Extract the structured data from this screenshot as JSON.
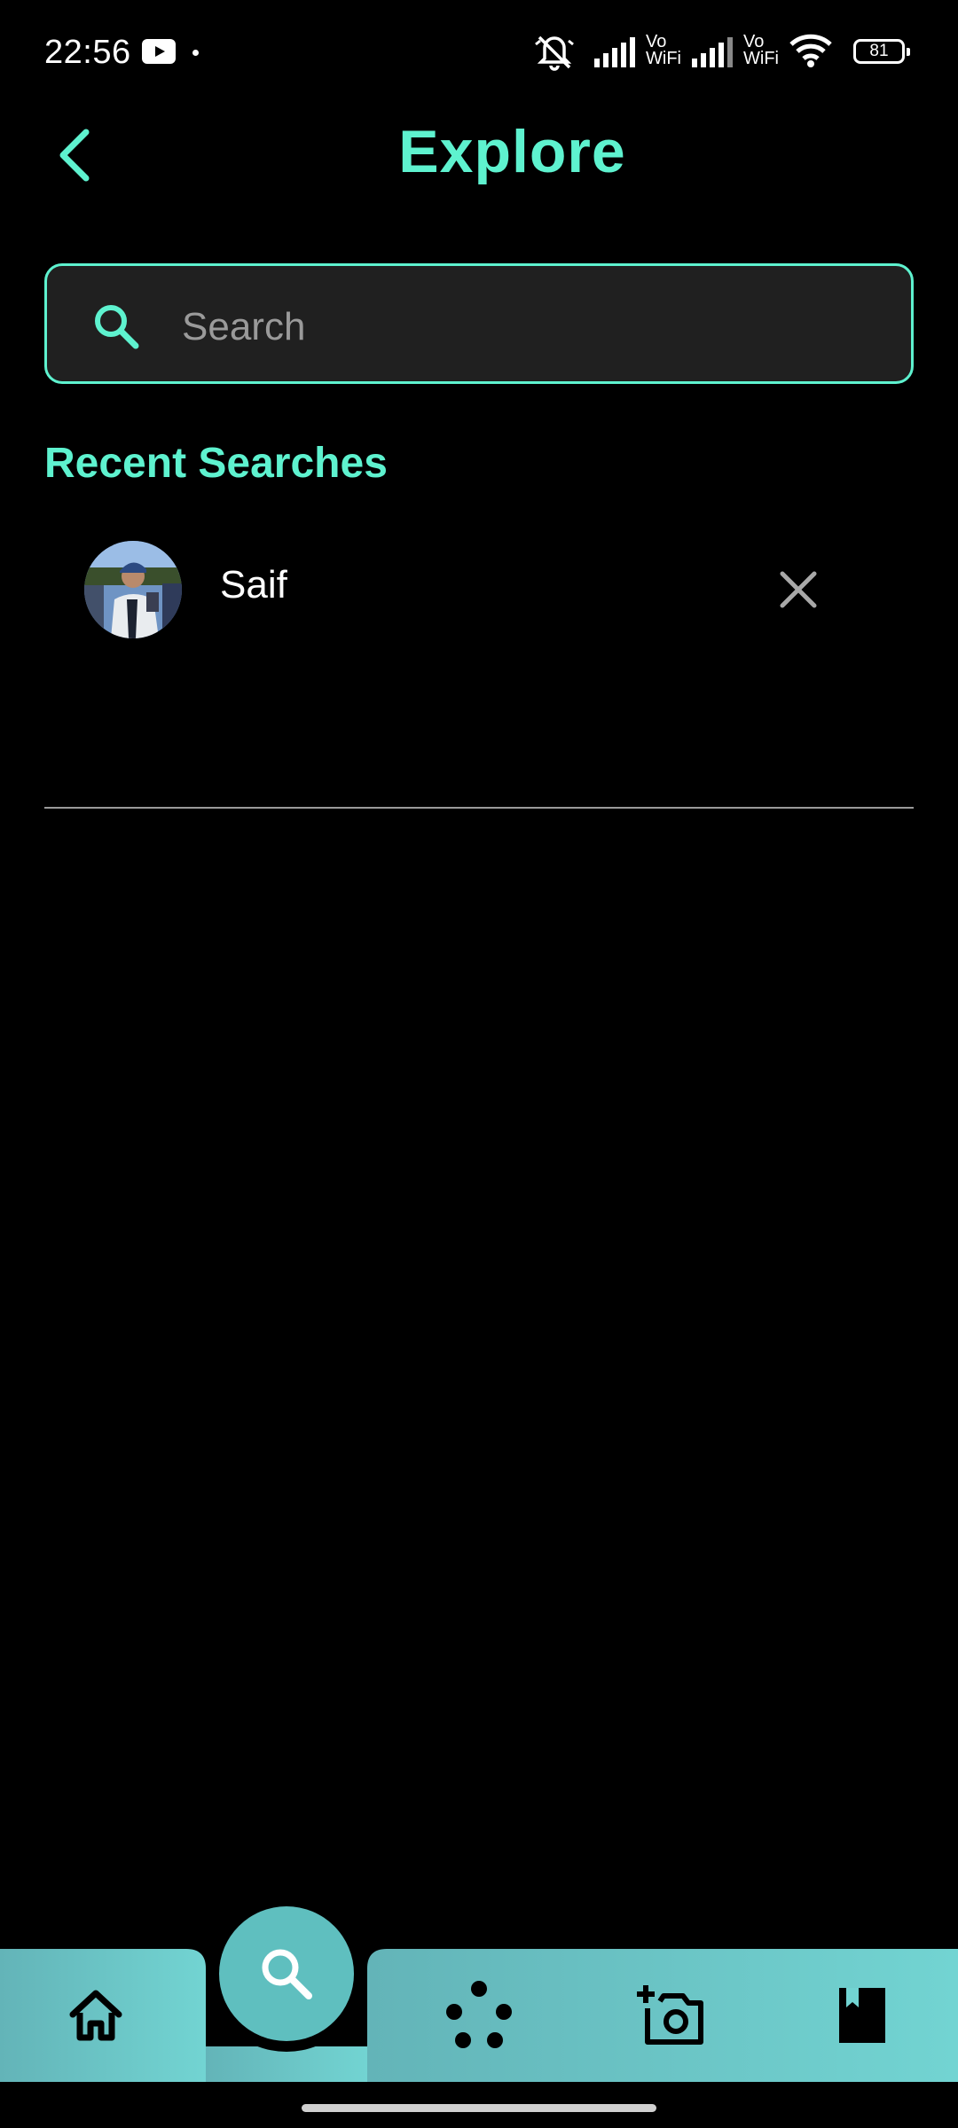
{
  "status_bar": {
    "time": "22:56",
    "battery": "81",
    "network_label_1": "Vo\nWiFi",
    "network_label_2": "Vo\nWiFi",
    "icons": [
      "youtube-icon",
      "notification-dot",
      "mute-icon",
      "signal-icon",
      "signal-icon",
      "wifi-icon",
      "battery-icon"
    ]
  },
  "header": {
    "title": "Explore",
    "back_icon": "chevron-left-icon"
  },
  "search": {
    "placeholder": "Search",
    "value": "",
    "icon": "search-icon"
  },
  "recent": {
    "title": "Recent Searches",
    "items": [
      {
        "name": "Saif",
        "remove_icon": "close-icon"
      }
    ]
  },
  "bottom_nav": {
    "items": [
      {
        "icon": "home-icon"
      },
      {
        "icon": "search-icon",
        "active": true
      },
      {
        "icon": "dots-icon"
      },
      {
        "icon": "add-photo-icon"
      },
      {
        "icon": "bookmark-icon"
      }
    ]
  },
  "colors": {
    "accent": "#5ef2cf",
    "background": "#000000",
    "search_bg": "#202020",
    "nav_bg_start": "#63b4b8",
    "nav_bg_end": "#72d4d2"
  }
}
